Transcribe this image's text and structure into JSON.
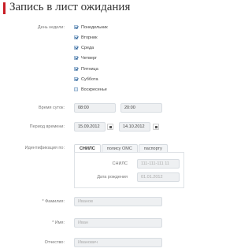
{
  "page_title": "Запись в лист ожидания",
  "days": {
    "label": "День недели:",
    "items": [
      {
        "label": "Понедельник",
        "checked": true
      },
      {
        "label": "Вторник",
        "checked": true
      },
      {
        "label": "Среда",
        "checked": true
      },
      {
        "label": "Четверг",
        "checked": true
      },
      {
        "label": "Пятница",
        "checked": true
      },
      {
        "label": "Суббота",
        "checked": true
      },
      {
        "label": "Воскресенье",
        "checked": false
      }
    ]
  },
  "time": {
    "label": "Время суток:",
    "from": "08:00",
    "to": "20:00"
  },
  "period": {
    "label": "Период времени:",
    "from": "15.09.2012",
    "to": "14.10.2012"
  },
  "identification": {
    "label": "Идентификация по:",
    "tabs": [
      "СНИЛС",
      "полису ОМС",
      "паспорту"
    ],
    "active_tab": "СНИЛС",
    "snils_label": "СНИЛС",
    "snils_placeholder": "111-111-111 11",
    "birth_label": "Дата рождения",
    "birth_placeholder": "01.01.2012"
  },
  "surname": {
    "label": "* Фамилия:",
    "placeholder": "Иванов"
  },
  "name": {
    "label": "* Имя:",
    "placeholder": "Иван"
  },
  "patronymic": {
    "label": "Отчество:",
    "placeholder": "Иванович"
  },
  "colors": {
    "accent": "#c81d25",
    "checkbox": "#dce9f5"
  }
}
